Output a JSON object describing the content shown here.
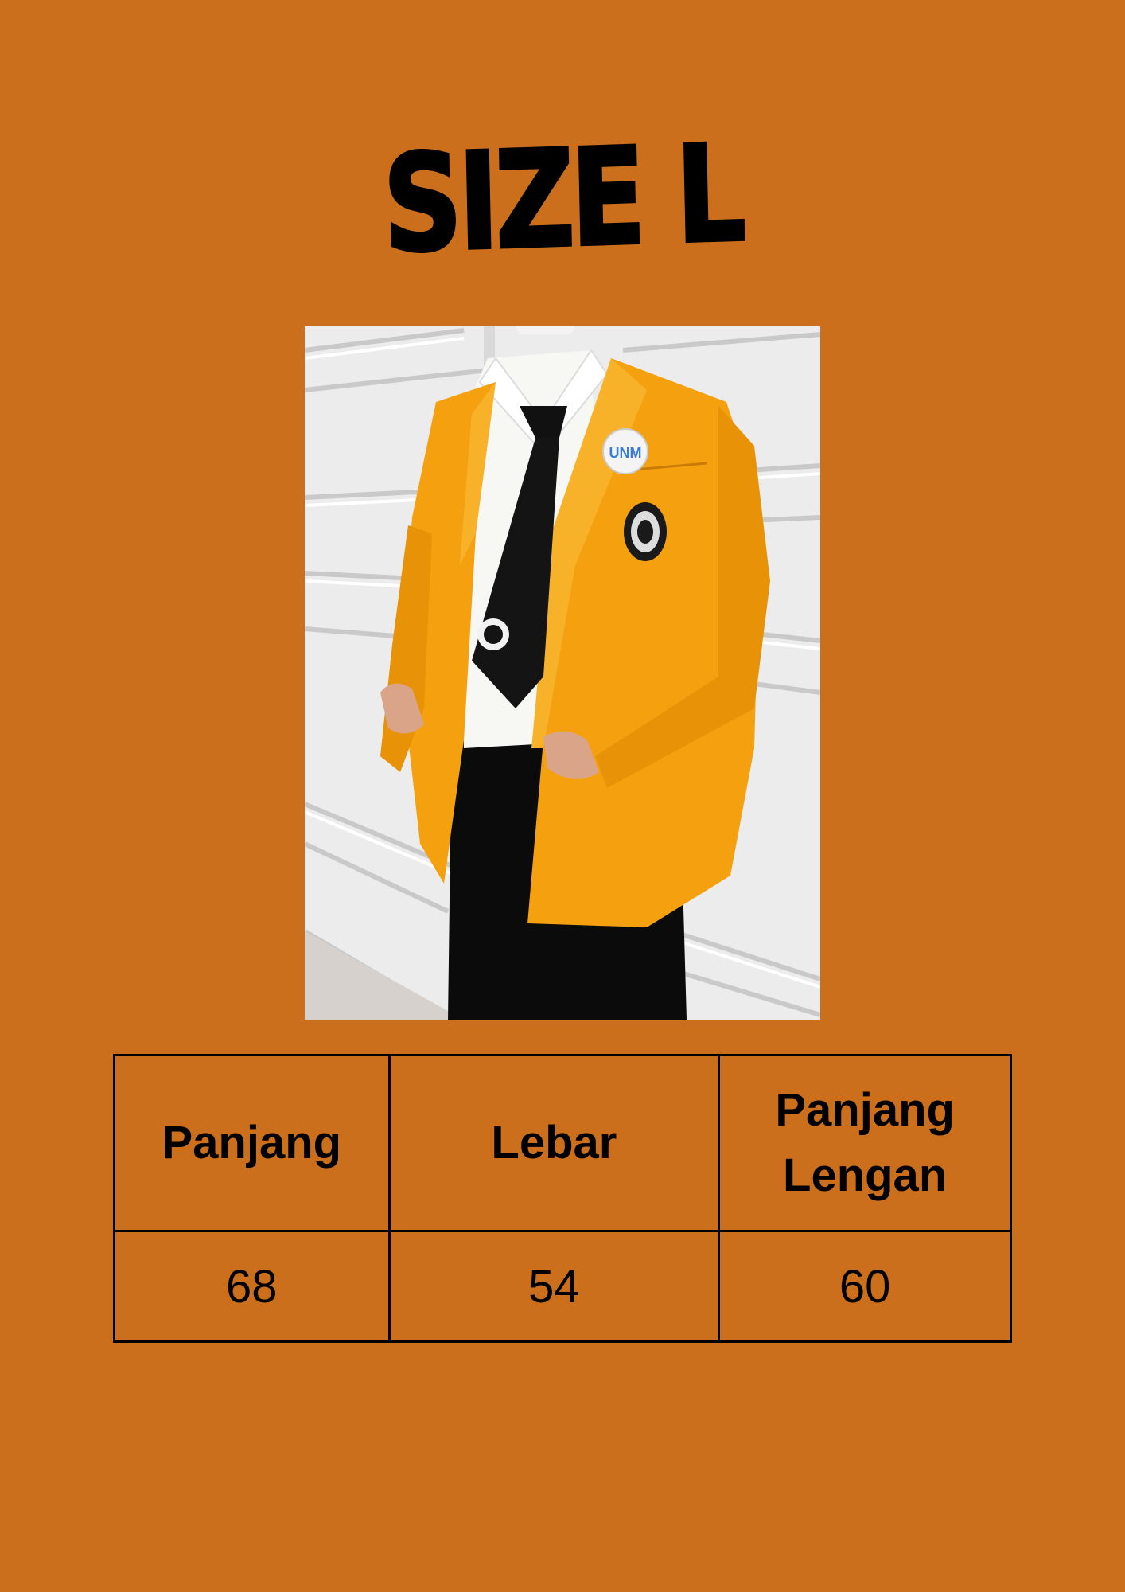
{
  "title": "SIZE L",
  "table": {
    "headers": [
      "Panjang",
      "Lebar",
      "Panjang Lengan"
    ],
    "values": [
      "68",
      "54",
      "60"
    ]
  },
  "colors": {
    "background": "#CB6F1D",
    "jacket": "#F5A10F",
    "text": "#000000"
  }
}
